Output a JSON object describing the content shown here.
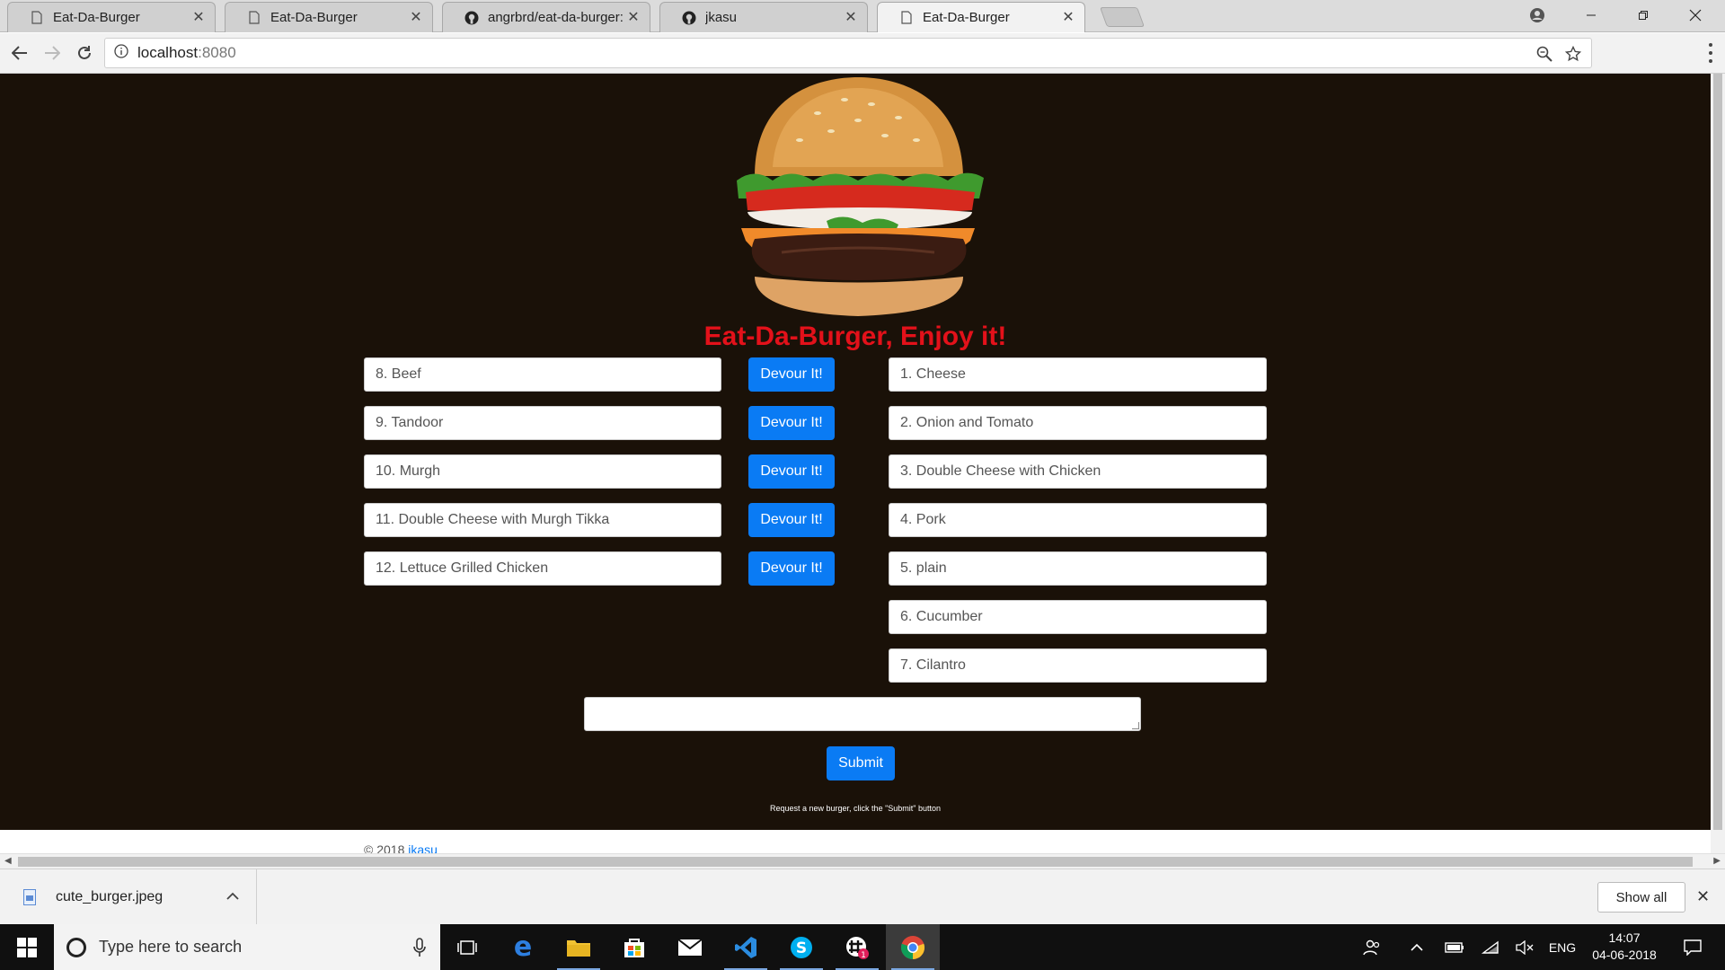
{
  "browser": {
    "tabs": [
      {
        "title": "Eat-Da-Burger",
        "icon": "page-icon",
        "active": false
      },
      {
        "title": "Eat-Da-Burger",
        "icon": "page-icon",
        "active": false
      },
      {
        "title": "angrbrd/eat-da-burger: A",
        "icon": "github-icon",
        "active": false
      },
      {
        "title": "jkasu",
        "icon": "github-icon",
        "active": false
      },
      {
        "title": "Eat-Da-Burger",
        "icon": "page-icon",
        "active": true
      }
    ],
    "address": {
      "host": "localhost",
      "port": ":8080"
    }
  },
  "page": {
    "heading": "Eat-Da-Burger, Enjoy it!",
    "uneaten": [
      {
        "name": "8. Beef",
        "button": "Devour It!"
      },
      {
        "name": "9. Tandoor",
        "button": "Devour It!"
      },
      {
        "name": "10. Murgh",
        "button": "Devour It!"
      },
      {
        "name": "11. Double Cheese with Murgh Tikka",
        "button": "Devour It!"
      },
      {
        "name": "12. Lettuce Grilled Chicken",
        "button": "Devour It!"
      }
    ],
    "devoured": [
      "1. Cheese",
      "2. Onion and Tomato",
      "3. Double Cheese with Chicken",
      "4. Pork",
      "5. plain",
      "6. Cucumber",
      "7. Cilantro"
    ],
    "new_burger_value": "",
    "submit_label": "Submit",
    "hint": "Request a new burger, click the \"Submit\" button",
    "footer": {
      "copyright": "© 2018",
      "link": "jkasu"
    },
    "colors": {
      "heading": "#e3111a",
      "button": "#0a7bf4",
      "background": "#1a1108"
    }
  },
  "downloads": {
    "file": "cute_burger.jpeg",
    "show_all": "Show all"
  },
  "taskbar": {
    "search_placeholder": "Type here to search",
    "language": "ENG",
    "time": "14:07",
    "date": "04-06-2018",
    "apps": [
      "task-view-icon",
      "edge-icon",
      "file-explorer-icon",
      "store-icon",
      "mail-icon",
      "vscode-icon",
      "skype-icon",
      "slack-icon",
      "chrome-icon"
    ]
  }
}
